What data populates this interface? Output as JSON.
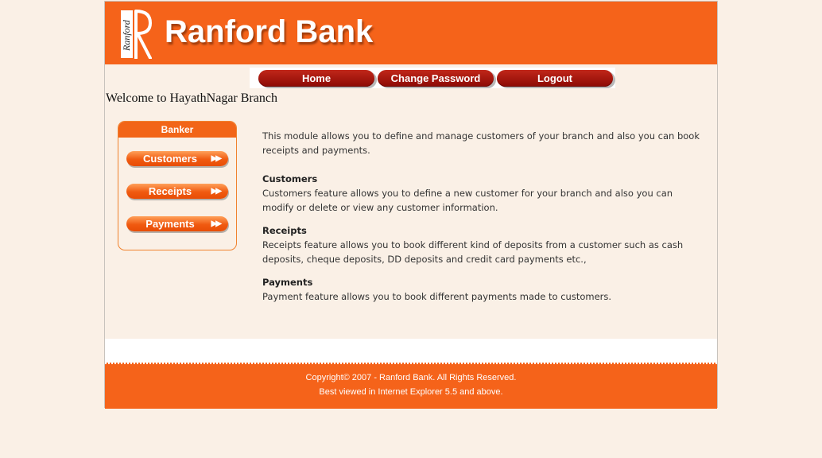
{
  "header": {
    "logo_text": "Ranford Bank",
    "logo_mark_text": "Ranford"
  },
  "nav": {
    "home": "Home",
    "change_password": "Change Password",
    "logout": "Logout"
  },
  "welcome": "Welcome to HayathNagar Branch",
  "sidebar": {
    "title": "Banker",
    "items": [
      {
        "label": "Customers",
        "icon": "double-chevron-right-icon"
      },
      {
        "label": "Receipts",
        "icon": "double-chevron-right-icon"
      },
      {
        "label": "Payments",
        "icon": "double-chevron-right-icon"
      }
    ]
  },
  "content": {
    "intro": "This module allows you to define and manage customers of your branch and also you can book receipts and payments.",
    "sections": [
      {
        "title": "Customers",
        "text": "Customers feature allows you to define a new customer for your branch and also you can modify or delete or view any customer information."
      },
      {
        "title": "Receipts",
        "text": "Receipts feature allows you to book different kind of deposits from a customer such as cash deposits, cheque deposits, DD deposits and credit card payments etc.,"
      },
      {
        "title": "Payments",
        "text": "Payment feature allows you to book different payments made to customers."
      }
    ]
  },
  "footer": {
    "copyright": "Copyright© 2007 - Ranford Bank. All Rights Reserved.",
    "browser_note": "Best viewed in Internet Explorer 5.5 and above."
  },
  "colors": {
    "brand_orange": "#f5631a",
    "nav_red": "#a8170e",
    "page_bg": "#faf0e6"
  }
}
